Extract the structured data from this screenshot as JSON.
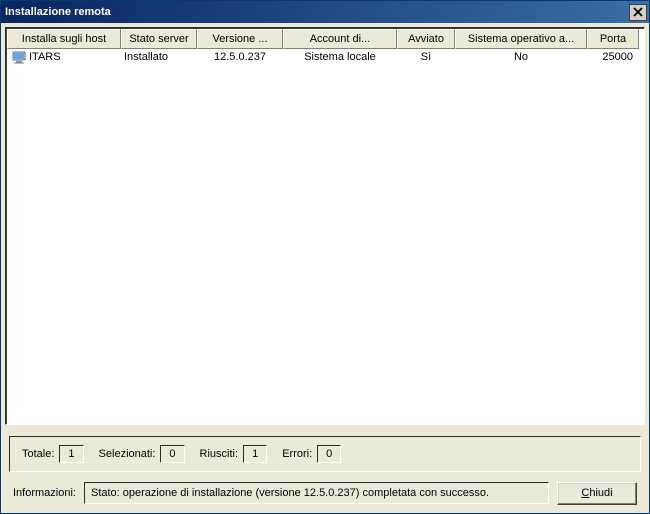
{
  "window": {
    "title": "Installazione remota"
  },
  "columns": {
    "host": "Installa sugli host",
    "serverState": "Stato server",
    "version": "Versione ...",
    "account": "Account di...",
    "started": "Avviato",
    "os": "Sistema operativo a...",
    "port": "Porta"
  },
  "rows": [
    {
      "host": "ITARS",
      "serverState": "Installato",
      "version": "12.5.0.237",
      "account": "Sistema locale",
      "started": "Sì",
      "os": "No",
      "port": "25000"
    }
  ],
  "stats": {
    "totalLabel": "Totale:",
    "totalValue": "1",
    "selectedLabel": "Selezionati:",
    "selectedValue": "0",
    "successLabel": "Riusciti:",
    "successValue": "1",
    "errorsLabel": "Errori:",
    "errorsValue": "0"
  },
  "info": {
    "label": "Informazioni:",
    "text": "Stato: operazione di installazione (versione 12.5.0.237) completata con successo."
  },
  "buttons": {
    "close": "Chiudi",
    "closeAccess": "C"
  }
}
